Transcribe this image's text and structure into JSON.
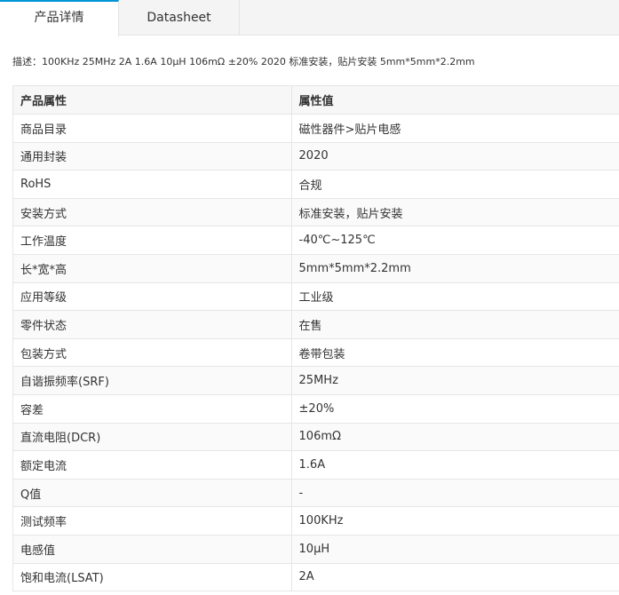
{
  "tabs": [
    {
      "label": "产品详情"
    },
    {
      "label": "Datasheet"
    }
  ],
  "description": "描述：100KHz 25MHz 2A 1.6A 10μH 106mΩ ±20% 2020 标准安装，贴片安装 5mm*5mm*2.2mm",
  "table": {
    "headers": [
      "产品属性",
      "属性值"
    ],
    "rows": [
      [
        "商品目录",
        "磁性器件>贴片电感"
      ],
      [
        "通用封装",
        "2020"
      ],
      [
        "RoHS",
        "合规"
      ],
      [
        "安装方式",
        "标准安装，贴片安装"
      ],
      [
        "工作温度",
        "-40℃~125℃"
      ],
      [
        "长*宽*高",
        "5mm*5mm*2.2mm"
      ],
      [
        "应用等级",
        "工业级"
      ],
      [
        "零件状态",
        "在售"
      ],
      [
        "包装方式",
        "卷带包装"
      ],
      [
        "自谐振频率(SRF)",
        "25MHz"
      ],
      [
        "容差",
        "±20%"
      ],
      [
        "直流电阻(DCR)",
        "106mΩ"
      ],
      [
        "额定电流",
        "1.6A"
      ],
      [
        "Q值",
        "-"
      ],
      [
        "测试频率",
        "100KHz"
      ],
      [
        "电感值",
        "10μH"
      ],
      [
        "饱和电流(LSAT)",
        "2A"
      ]
    ]
  }
}
